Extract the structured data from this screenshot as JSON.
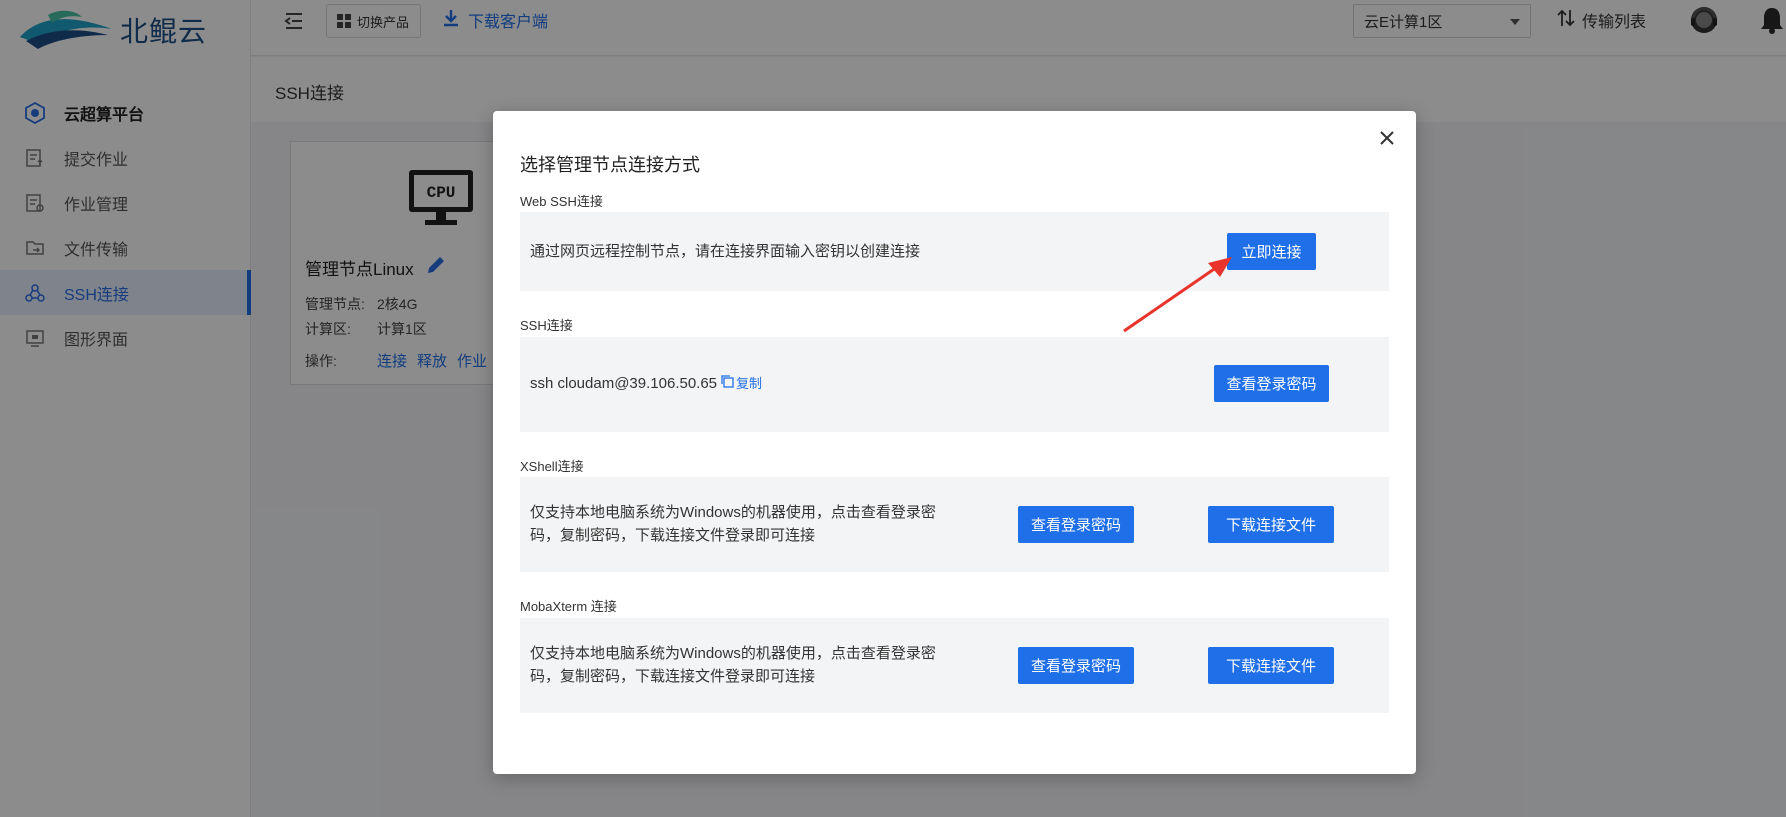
{
  "app": {
    "logo_text": "北鲲云"
  },
  "sidebar": {
    "items": [
      {
        "label": "云超算平台",
        "icon": "cloud-platform-icon"
      },
      {
        "label": "提交作业",
        "icon": "submit-job-icon"
      },
      {
        "label": "作业管理",
        "icon": "job-manage-icon"
      },
      {
        "label": "文件传输",
        "icon": "file-transfer-icon"
      },
      {
        "label": "SSH连接",
        "icon": "ssh-icon"
      },
      {
        "label": "图形界面",
        "icon": "gui-icon"
      }
    ],
    "active_index": 4
  },
  "topbar": {
    "switch_product": "切换产品",
    "download_client": "下载客户端",
    "region": "云E计算1区",
    "transfer_list": "传输列表"
  },
  "page": {
    "title": "SSH连接"
  },
  "node_card": {
    "cpu_label": "CPU",
    "name": "管理节点Linux",
    "spec_key": "管理节点:",
    "spec_val": "2核4G",
    "zone_key": "计算区:",
    "zone_val": "计算1区",
    "ops_key": "操作:",
    "ops": [
      "连接",
      "释放",
      "作业"
    ]
  },
  "modal": {
    "title": "选择管理节点连接方式",
    "web_ssh": {
      "label": "Web SSH连接",
      "text": "通过网页远程控制节点，请在连接界面输入密钥以创建连接",
      "button": "立即连接"
    },
    "ssh": {
      "label": "SSH连接",
      "command": "ssh cloudam@39.106.50.65",
      "copy": "复制",
      "button": "查看登录密码"
    },
    "xshell": {
      "label": "XShell连接",
      "text_line1": "仅支持本地电脑系统为Windows的机器使用，点击查看登录密",
      "text_line2": "码，复制密码，下载连接文件登录即可连接",
      "view_button": "查看登录密码",
      "download_button": "下载连接文件"
    },
    "mobaxterm": {
      "label": "MobaXterm  连接",
      "text_line1": "仅支持本地电脑系统为Windows的机器使用，点击查看登录密",
      "text_line2": "码，复制密码，下载连接文件登录即可连接",
      "view_button": "查看登录密码",
      "download_button": "下载连接文件"
    }
  },
  "colors": {
    "accent": "#1f6fe8",
    "annotation_arrow": "#e8342b"
  }
}
